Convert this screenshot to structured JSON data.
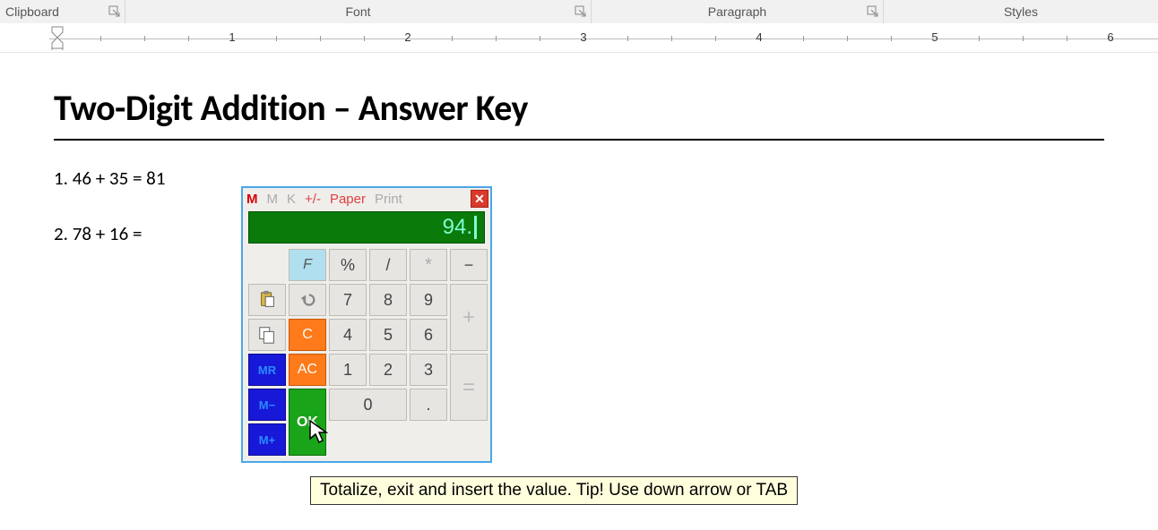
{
  "ribbon": {
    "groups": {
      "clipboard": "Clipboard",
      "font": "Font",
      "paragraph": "Paragraph",
      "styles": "Styles"
    }
  },
  "ruler": {
    "ticks": [
      "1",
      "2",
      "3",
      "4",
      "5",
      "6"
    ]
  },
  "document": {
    "title": "Two-Digit Addition – Answer Key",
    "line1": "1. 46 + 35 = 81",
    "line2": "2. 78 + 16 ="
  },
  "calculator": {
    "menu": {
      "m1": "M",
      "m2": "M",
      "m3": "K",
      "pm": "+/-",
      "paper": "Paper",
      "print": "Print"
    },
    "display": "94.",
    "keys": {
      "f": "F",
      "pct": "%",
      "div": "/",
      "mul": "*",
      "sub": "−",
      "c": "C",
      "ac": "AC",
      "mr": "MR",
      "mminus": "M−",
      "mplus": "M+",
      "ok": "OK",
      "n7": "7",
      "n8": "8",
      "n9": "9",
      "n4": "4",
      "n5": "5",
      "n6": "6",
      "plus": "+",
      "n1": "1",
      "n2": "2",
      "n3": "3",
      "eq": "=",
      "n0": "0",
      "dot": "."
    }
  },
  "tooltip": "Totalize, exit and insert the value. Tip! Use down arrow or TAB"
}
